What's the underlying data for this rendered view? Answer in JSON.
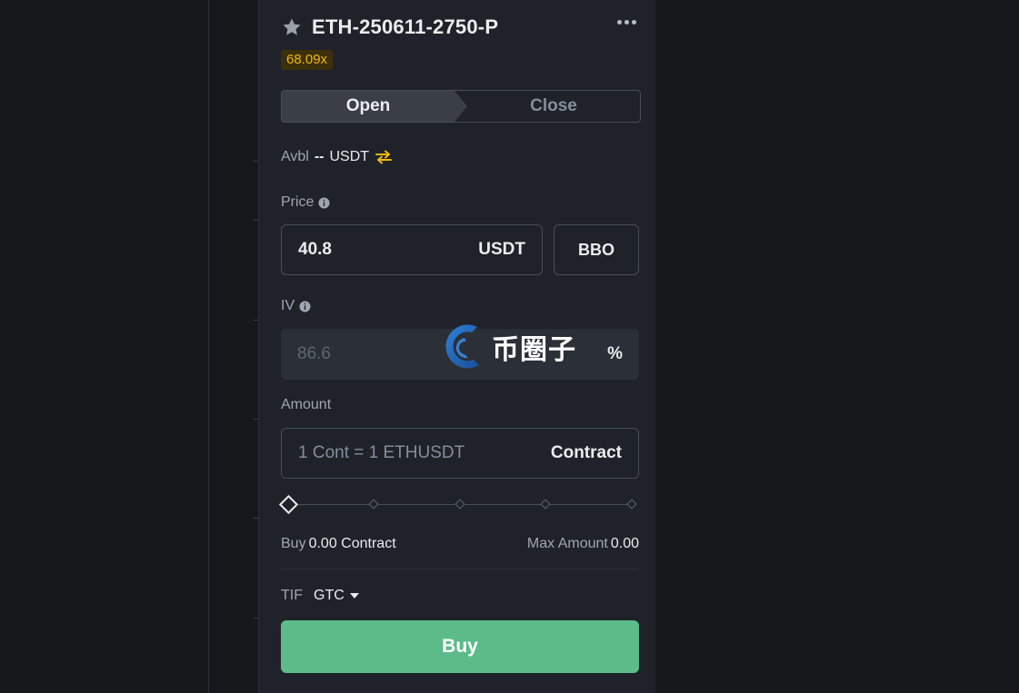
{
  "header": {
    "symbol": "ETH-250611-2750-P",
    "leverage": "68.09x"
  },
  "tabs": [
    {
      "label": "Open",
      "active": true
    },
    {
      "label": "Close",
      "active": false
    }
  ],
  "available": {
    "label": "Avbl",
    "value": "--",
    "unit": "USDT"
  },
  "price": {
    "label": "Price",
    "value": "40.8",
    "unit": "USDT",
    "bbo_label": "BBO"
  },
  "iv": {
    "label": "IV",
    "value": "86.6",
    "unit": "%"
  },
  "amount": {
    "label": "Amount",
    "placeholder": "1 Cont = 1 ETHUSDT",
    "unit": "Contract",
    "slider_percent": 0
  },
  "summary": {
    "buy_label": "Buy",
    "buy_value": "0.00 Contract",
    "max_label": "Max Amount",
    "max_value": "0.00"
  },
  "tif": {
    "label": "TIF",
    "value": "GTC"
  },
  "buy_button": {
    "label": "Buy"
  },
  "watermark": {
    "text": "币圈子"
  },
  "colors": {
    "buy": "#5cbc89",
    "accent": "#f0b90b",
    "panel": "#1f2329",
    "background": "#15171b"
  }
}
